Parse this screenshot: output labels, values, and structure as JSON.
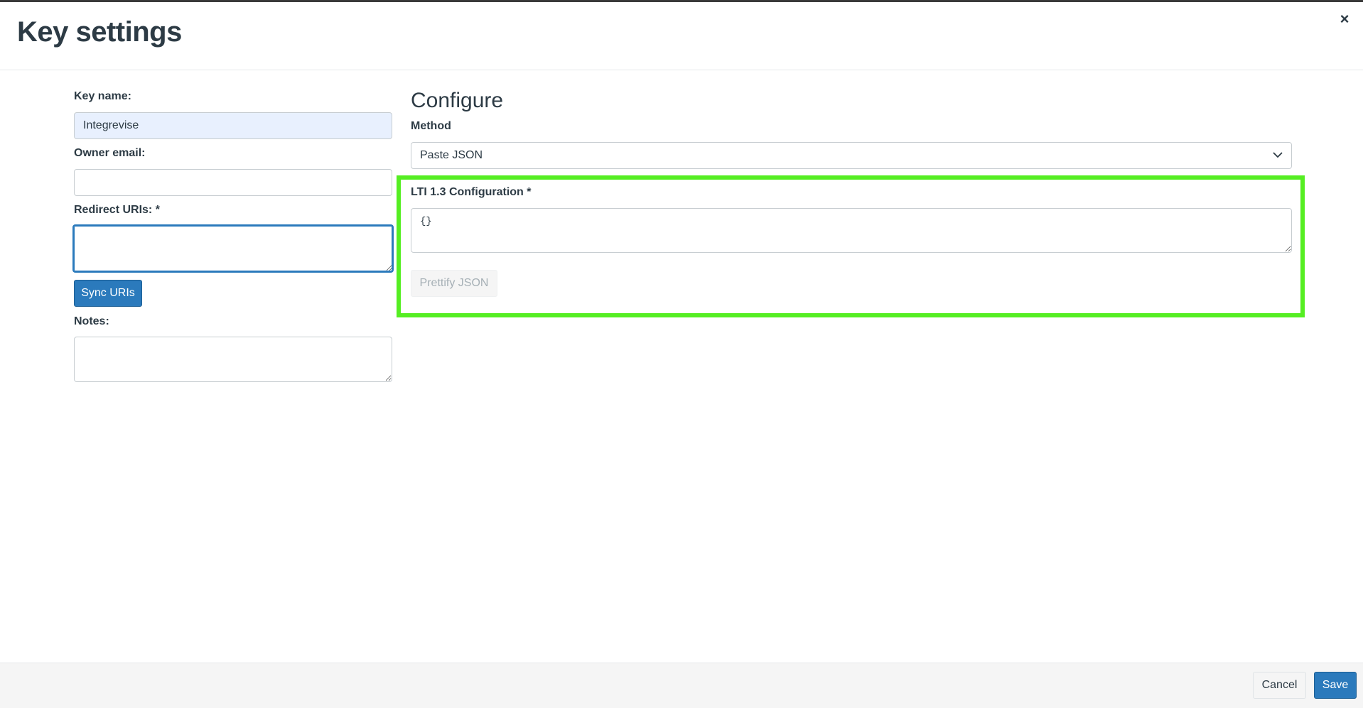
{
  "dialog": {
    "title": "Key settings",
    "close_label": "×"
  },
  "form": {
    "key_name_label": "Key name:",
    "key_name_value": "Integrevise",
    "owner_email_label": "Owner email:",
    "owner_email_value": "",
    "redirect_uris_label": "Redirect URIs: *",
    "redirect_uris_value": "",
    "sync_uris_label": "Sync URIs",
    "notes_label": "Notes:",
    "notes_value": ""
  },
  "configure": {
    "title": "Configure",
    "method_label": "Method",
    "method_selected": "Paste JSON",
    "lti_config_label": "LTI 1.3 Configuration *",
    "lti_config_value": "{}",
    "prettify_label": "Prettify JSON"
  },
  "footer": {
    "cancel_label": "Cancel",
    "save_label": "Save"
  },
  "colors": {
    "primary": "#2b7abc",
    "highlight": "#55ee22",
    "text": "#2d3b45",
    "autofill_bg": "#e8f0fe"
  },
  "icons": {
    "close": "close-icon",
    "select_arrow": "chevron-down-icon"
  }
}
